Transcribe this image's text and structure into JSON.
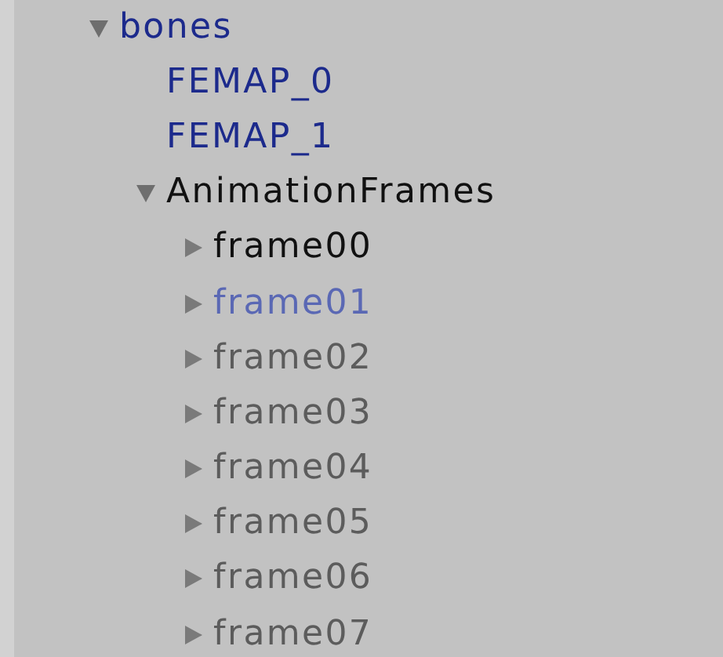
{
  "hierarchy": {
    "items": [
      {
        "label": "bones",
        "kind": "prefab",
        "active": true,
        "expandable": true,
        "expanded": true,
        "children": [
          {
            "label": "FEMAP_0",
            "kind": "prefab",
            "active": true,
            "expandable": false,
            "expanded": false
          },
          {
            "label": "FEMAP_1",
            "kind": "prefab",
            "active": true,
            "expandable": false,
            "expanded": false
          },
          {
            "label": "AnimationFrames",
            "kind": "object",
            "active": true,
            "expandable": true,
            "expanded": true,
            "children": [
              {
                "label": "frame00",
                "kind": "object",
                "active": true,
                "expandable": true,
                "expanded": false
              },
              {
                "label": "frame01",
                "kind": "prefab",
                "active": false,
                "expandable": true,
                "expanded": false
              },
              {
                "label": "frame02",
                "kind": "object",
                "active": false,
                "expandable": true,
                "expanded": false
              },
              {
                "label": "frame03",
                "kind": "object",
                "active": false,
                "expandable": true,
                "expanded": false
              },
              {
                "label": "frame04",
                "kind": "object",
                "active": false,
                "expandable": true,
                "expanded": false
              },
              {
                "label": "frame05",
                "kind": "object",
                "active": false,
                "expandable": true,
                "expanded": false
              },
              {
                "label": "frame06",
                "kind": "object",
                "active": false,
                "expandable": true,
                "expanded": false
              },
              {
                "label": "frame07",
                "kind": "object",
                "active": false,
                "expandable": true,
                "expanded": false
              }
            ]
          }
        ]
      }
    ]
  }
}
